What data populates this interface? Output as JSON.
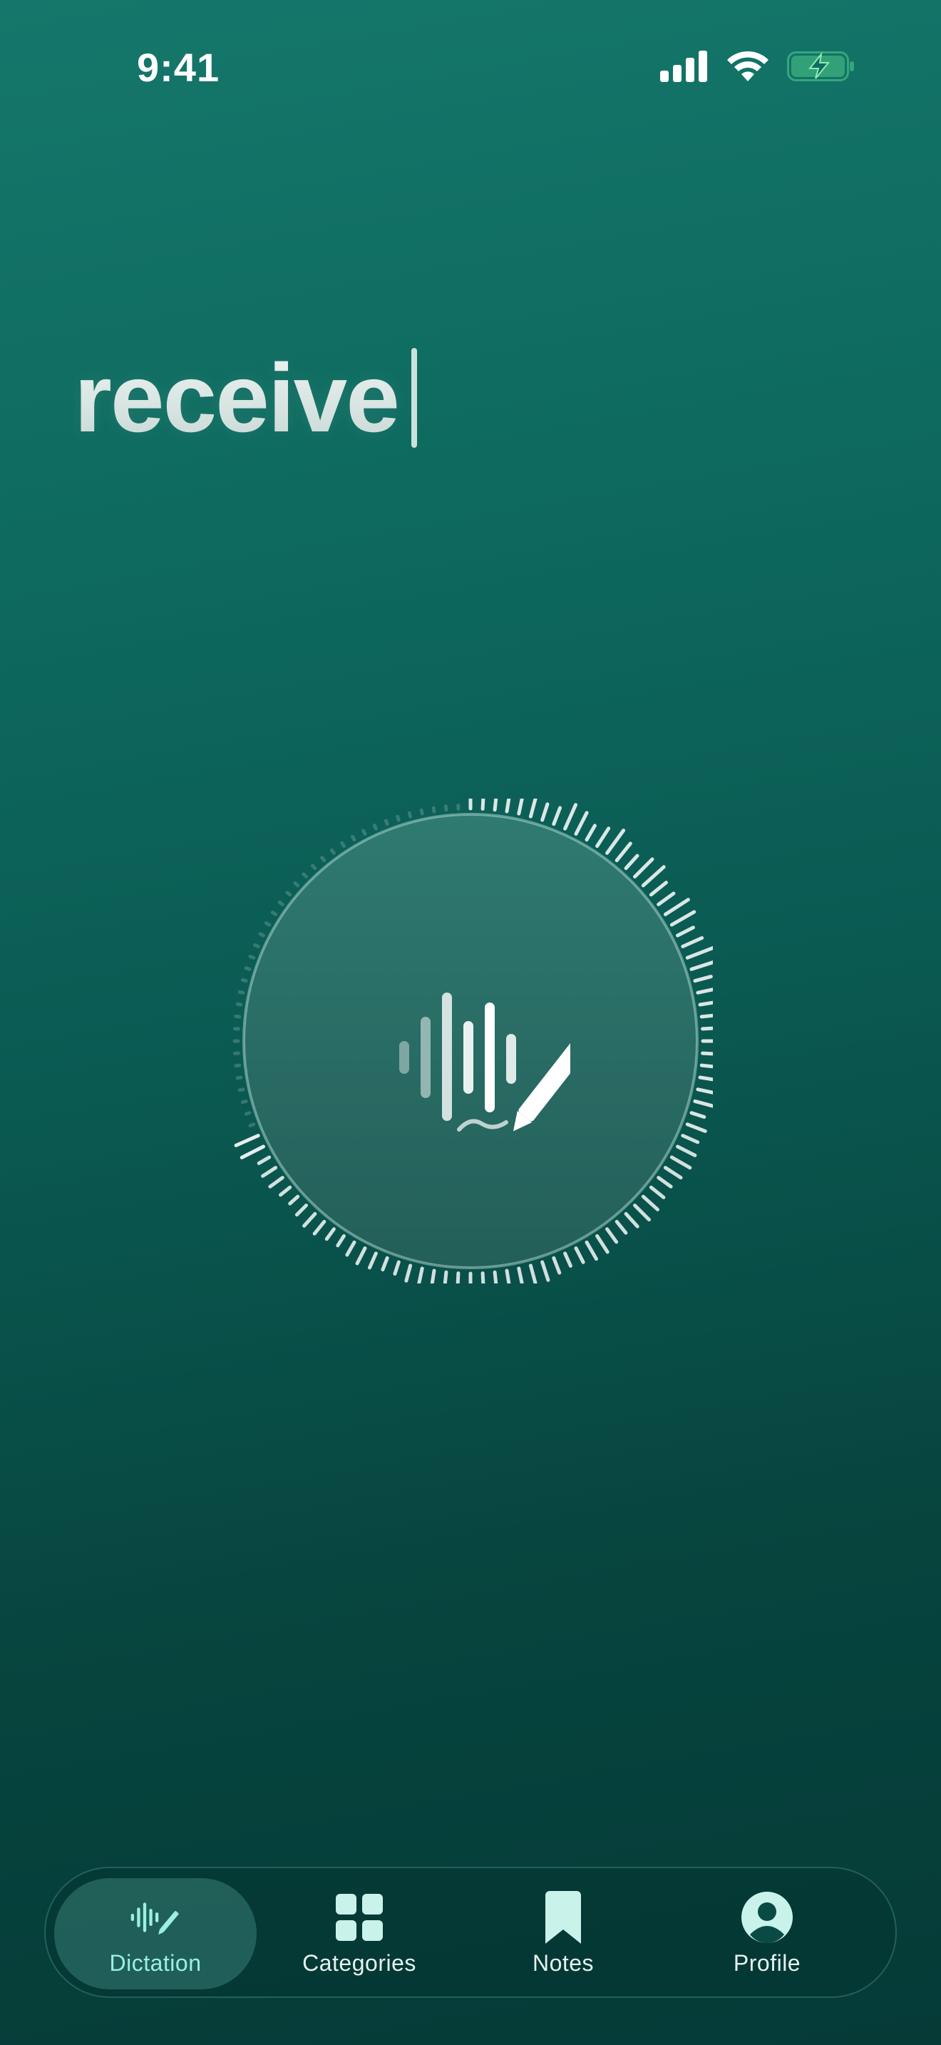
{
  "status_bar": {
    "time": "9:41"
  },
  "dictation": {
    "text": "receive"
  },
  "record_button": {
    "icon": "waveform-pencil-icon"
  },
  "tabs": [
    {
      "label": "Dictation",
      "icon": "waveform-pencil-icon",
      "active": true
    },
    {
      "label": "Categories",
      "icon": "grid-icon",
      "active": false
    },
    {
      "label": "Notes",
      "icon": "bookmark-icon",
      "active": false
    },
    {
      "label": "Profile",
      "icon": "person-circle-icon",
      "active": false
    }
  ],
  "colors": {
    "background_top": "#15776B",
    "background_bottom": "#053A37",
    "accent": "#9CF0E2",
    "battery_fill": "#4FC987"
  }
}
